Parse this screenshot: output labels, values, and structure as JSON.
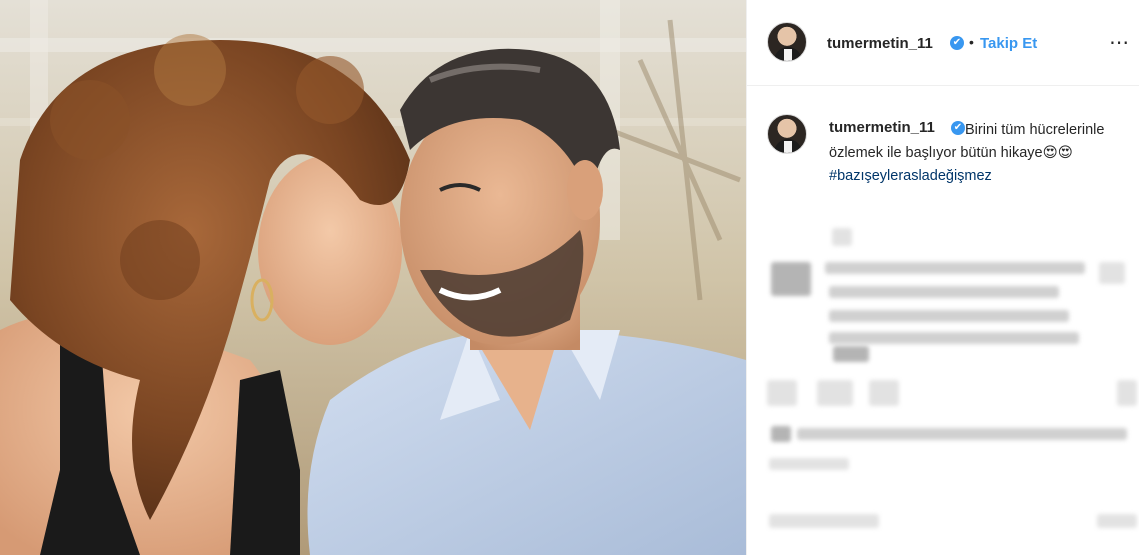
{
  "post": {
    "username": "tumermetin_11",
    "verified_mark": "✔",
    "separator": "•",
    "follow_label": "Takip Et",
    "more_icon": "⋯"
  },
  "caption": {
    "username": "tumermetin_11",
    "text": "Birini tüm hücrelerinle özlemek ile başlıyor bütün hikaye😍😍",
    "hashtag": "#bazışeylerasladeğişmez"
  },
  "icons": {
    "avatar": "avatar-icon",
    "verified": "verified-badge-icon",
    "more": "more-options-icon"
  },
  "colors": {
    "link_blue": "#3897f0",
    "hashtag_blue": "#003569",
    "text": "#262626",
    "border": "#efefef"
  }
}
